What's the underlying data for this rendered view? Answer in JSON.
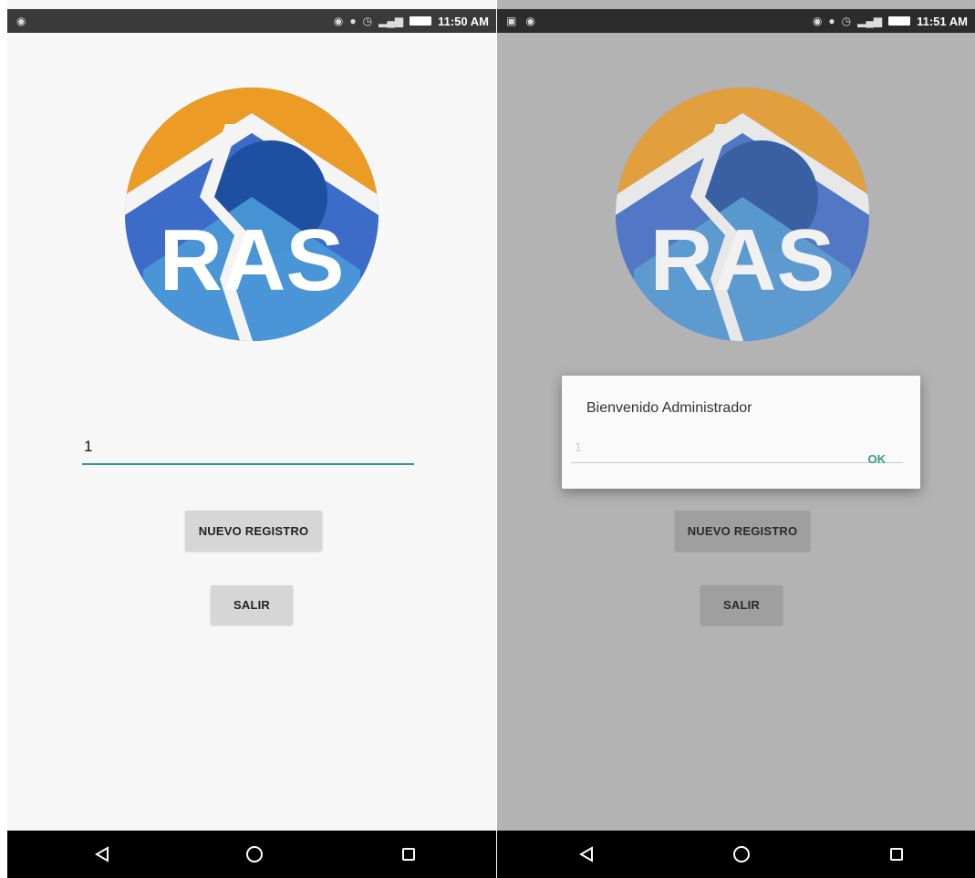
{
  "left": {
    "status": {
      "time": "11:50 AM"
    },
    "field": {
      "value": "1"
    },
    "buttons": {
      "new_label": "NUEVO REGISTRO",
      "exit_label": "SALIR"
    }
  },
  "right": {
    "status": {
      "time": "11:51 AM"
    },
    "dialog": {
      "message": "Bienvenido Administrador",
      "input_value": "1",
      "ok_label": "OK"
    },
    "buttons": {
      "new_label": "NUEVO REGISTRO",
      "exit_label": "SALIR"
    }
  },
  "colors": {
    "accent": "#2e9e86",
    "logo_orange": "#ec9b24",
    "logo_blue_dark": "#1f4fa0",
    "logo_blue_mid": "#3d6bc8",
    "logo_blue_light": "#4a9ad8"
  },
  "icons": {
    "status": [
      "android-debug-icon",
      "wifi-icon",
      "location-icon",
      "alarm-icon",
      "signal-icon",
      "battery-icon"
    ],
    "nav": [
      "back-icon",
      "home-icon",
      "recents-icon"
    ]
  }
}
